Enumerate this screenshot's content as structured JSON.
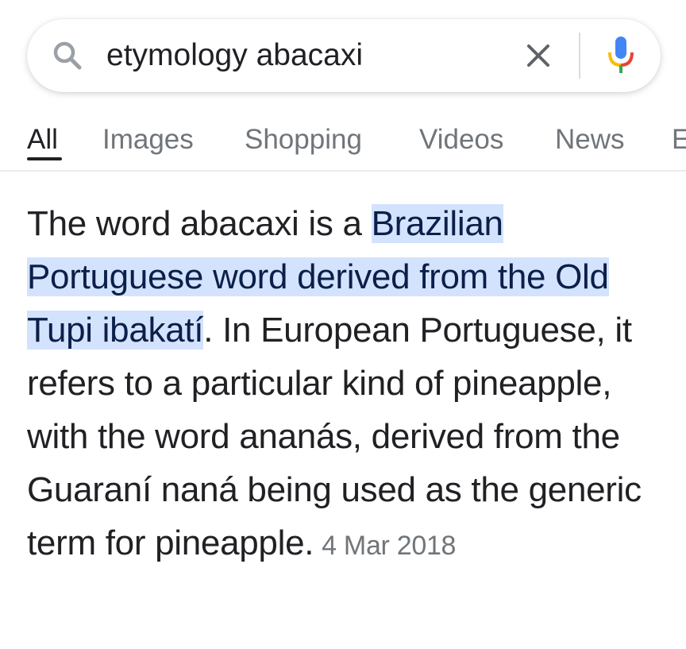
{
  "search": {
    "query": "etymology abacaxi"
  },
  "tabs": [
    {
      "label": "All",
      "active": true
    },
    {
      "label": "Images",
      "active": false
    },
    {
      "label": "Shopping",
      "active": false
    },
    {
      "label": "Videos",
      "active": false
    },
    {
      "label": "News",
      "active": false
    },
    {
      "label": "E",
      "active": false
    }
  ],
  "snippet": {
    "intro": "The word abacaxi is a ",
    "highlighted": "Brazilian Portuguese word derived from the Old Tupi ibakatí",
    "rest": ". In European Portuguese, it refers to a particular kind of pineapple, with the word ananás, derived from the Guaraní naná being used as the generic term for pineapple.",
    "date": "4 Mar 2018"
  },
  "icons": {
    "search": "search-icon",
    "clear": "close-icon",
    "mic": "mic-icon"
  },
  "colors": {
    "highlight_bg": "#d3e3fd",
    "mic_blue": "#4285f4",
    "mic_red": "#ea4335",
    "mic_yellow": "#fbbc04",
    "mic_green": "#34a853"
  }
}
